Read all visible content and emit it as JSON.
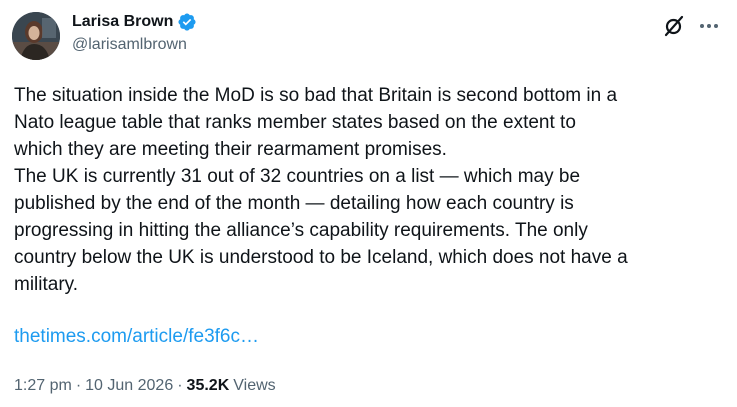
{
  "author": {
    "display_name": "Larisa Brown",
    "handle": "@larisamlbrown",
    "verified": true,
    "verified_color": "#1d9bf0"
  },
  "actions": {
    "grok_icon": "grok-icon",
    "more_icon": "more-options-icon"
  },
  "tweet": {
    "text": "The situation inside the MoD is so bad that Britain is second bottom in a\nNato league table that ranks member states based on the extent to\nwhich they are meeting their rearmament promises.\nThe UK is currently 31 out of 32 countries on a list — which may be\npublished by the end of the month — detailing how each country is\nprogressing in hitting the alliance’s capability requirements. The only\ncountry below the UK is understood to be Iceland, which does not have a\nmilitary.",
    "link": "thetimes.com/article/fe3f6c…",
    "link_color": "#1d9bf0"
  },
  "meta": {
    "time": "1:27 pm",
    "separator": "·",
    "date": "10 Jun 2026",
    "views_count": "35.2K",
    "views_label": "Views"
  }
}
